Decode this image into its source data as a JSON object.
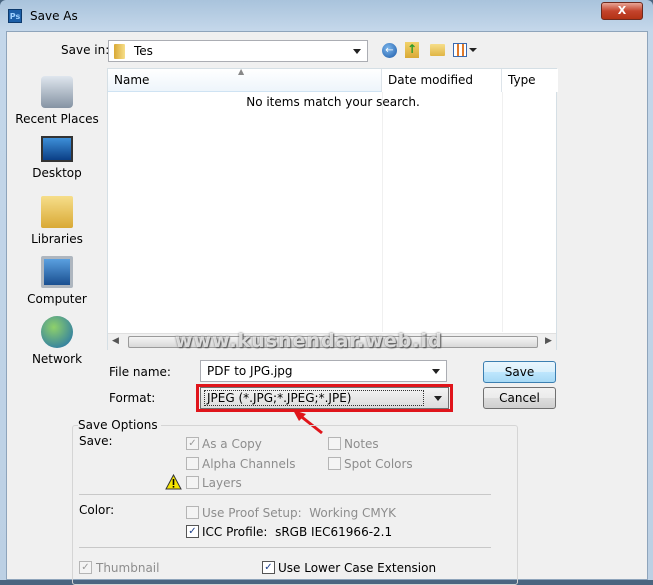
{
  "window": {
    "title": "Save As",
    "app_icon": "Ps",
    "close_label": "X"
  },
  "save_in": {
    "label": "Save in:",
    "value": "Tes"
  },
  "toolbar": {
    "icons": [
      "back-icon",
      "up-folder-icon",
      "new-folder-icon",
      "view-menu-icon"
    ]
  },
  "places": [
    {
      "label": "Recent Places",
      "icon": "recent-places-icon"
    },
    {
      "label": "Desktop",
      "icon": "desktop-icon"
    },
    {
      "label": "Libraries",
      "icon": "libraries-icon"
    },
    {
      "label": "Computer",
      "icon": "computer-icon"
    },
    {
      "label": "Network",
      "icon": "network-icon"
    }
  ],
  "file_list": {
    "columns": [
      "Name",
      "Date modified",
      "Type"
    ],
    "empty_message": "No items match your search."
  },
  "file_name": {
    "label": "File name:",
    "value": "PDF to JPG.jpg"
  },
  "format": {
    "label": "Format:",
    "value": "JPEG (*.JPG;*.JPEG;*.JPE)"
  },
  "buttons": {
    "save": "Save",
    "cancel": "Cancel"
  },
  "watermark": "www.kusnendar.web.id",
  "save_options": {
    "title": "Save Options",
    "save_label": "Save:",
    "as_a_copy": {
      "label": "As a Copy",
      "checked": true,
      "enabled": false
    },
    "notes": {
      "label": "Notes",
      "checked": false,
      "enabled": false
    },
    "alpha_channels": {
      "label": "Alpha Channels",
      "checked": false,
      "enabled": false
    },
    "spot_colors": {
      "label": "Spot Colors",
      "checked": false,
      "enabled": false
    },
    "layers": {
      "label": "Layers",
      "checked": false,
      "enabled": false
    },
    "color_label": "Color:",
    "use_proof_setup": {
      "label": "Use Proof Setup:  Working CMYK",
      "checked": false,
      "enabled": false
    },
    "icc_profile": {
      "label": "ICC Profile:  sRGB IEC61966-2.1",
      "checked": true,
      "enabled": true
    },
    "thumbnail": {
      "label": "Thumbnail",
      "checked": true,
      "enabled": false
    },
    "lower_case_ext": {
      "label": "Use Lower Case Extension",
      "checked": true,
      "enabled": true
    }
  },
  "colors": {
    "highlight": "#e0151b"
  }
}
